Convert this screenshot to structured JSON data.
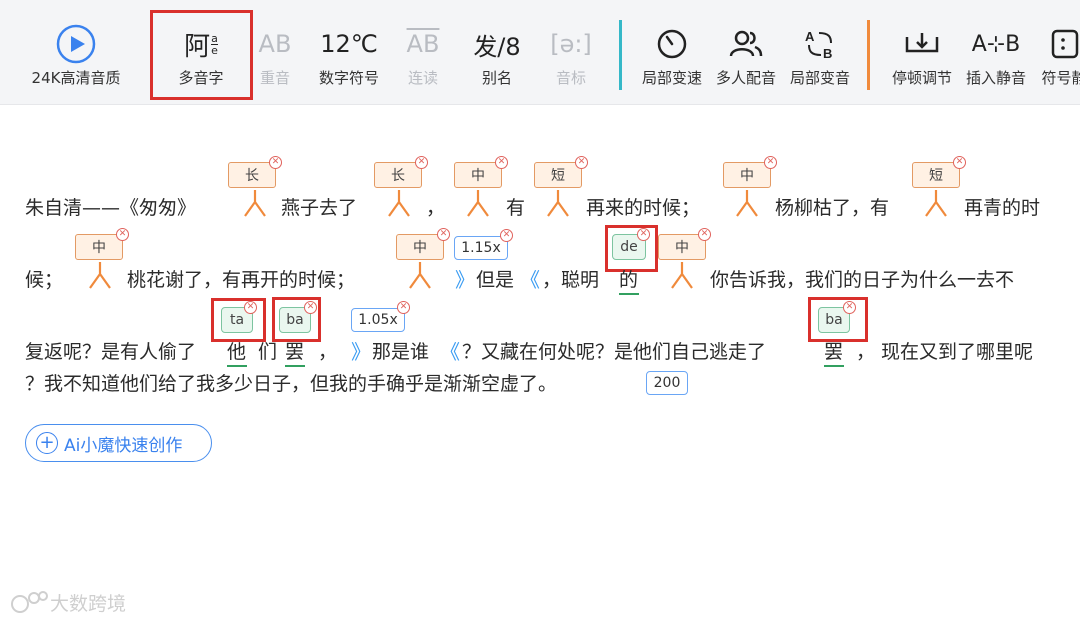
{
  "toolbar": {
    "items": [
      {
        "label": "24K高清音质",
        "icon": "play-circle-icon"
      },
      {
        "label": "多音字",
        "icon_text": "阿",
        "icon_sup": "a",
        "icon_sub": "e"
      },
      {
        "label": "重音",
        "icon_text": "AB",
        "disabled": true
      },
      {
        "label": "数字符号",
        "icon_text": "12℃"
      },
      {
        "label": "连读",
        "icon_text": "AB",
        "disabled": true
      },
      {
        "label": "别名",
        "icon_text": "发/8"
      },
      {
        "label": "音标",
        "icon_text": "[ə:]",
        "disabled": true
      },
      {
        "label": "局部变速",
        "icon": "speed-gauge-icon"
      },
      {
        "label": "多人配音",
        "icon": "people-icon"
      },
      {
        "label": "局部变音",
        "icon": "ab-swap-icon"
      },
      {
        "label": "停顿调节",
        "icon": "pause-adjust-icon"
      },
      {
        "label": "插入静音",
        "icon_text": "A⊹B"
      },
      {
        "label": "符号静",
        "icon": "symbol-silence-icon"
      }
    ],
    "separator_colors": [
      "#35b8c8",
      "#f08a3c"
    ]
  },
  "tags": {
    "long": "长",
    "mid": "中",
    "short": "短"
  },
  "rates": {
    "r1": "1.15x",
    "r2": "1.05x",
    "r3": "200"
  },
  "pinyin": {
    "de": "de",
    "ta": "ta",
    "ba1": "ba",
    "ba2": "ba"
  },
  "line1": {
    "t1": "朱自清——《匆匆》",
    "t2": "燕子去了",
    "t3": "，",
    "t4": "有",
    "t5": "再来的时候；",
    "t6": "杨柳枯了，有",
    "t7": "再青的时"
  },
  "line2": {
    "t1": "候；",
    "t2": "桃花谢了，有再开的时候；",
    "t3": "但是",
    "t4": "，聪明",
    "t5": "的",
    "t6": "你告诉我，我们的日子为什么一去不"
  },
  "line3": {
    "t1": "复返呢？是有人偷了",
    "t2": "他",
    "t3": "们",
    "t4": "罢",
    "t5": "，",
    "t6": "那是谁",
    "t7": "？又藏在何处呢？是他们自己逃走了",
    "t8": "罢",
    "t9": "，  现在又到了哪里呢"
  },
  "line4": {
    "t1": "？我不知道他们给了我多少日子，但我的手确乎是渐渐空虚了。"
  },
  "ai_button": {
    "label": "Ai小魔快速创作"
  },
  "watermark": {
    "text": "大数跨境"
  },
  "colors": {
    "accent_blue": "#3a82ee",
    "selection_red": "#d9302c",
    "pause_orange": "#f08a3c",
    "pinyin_green": "#32a060"
  }
}
